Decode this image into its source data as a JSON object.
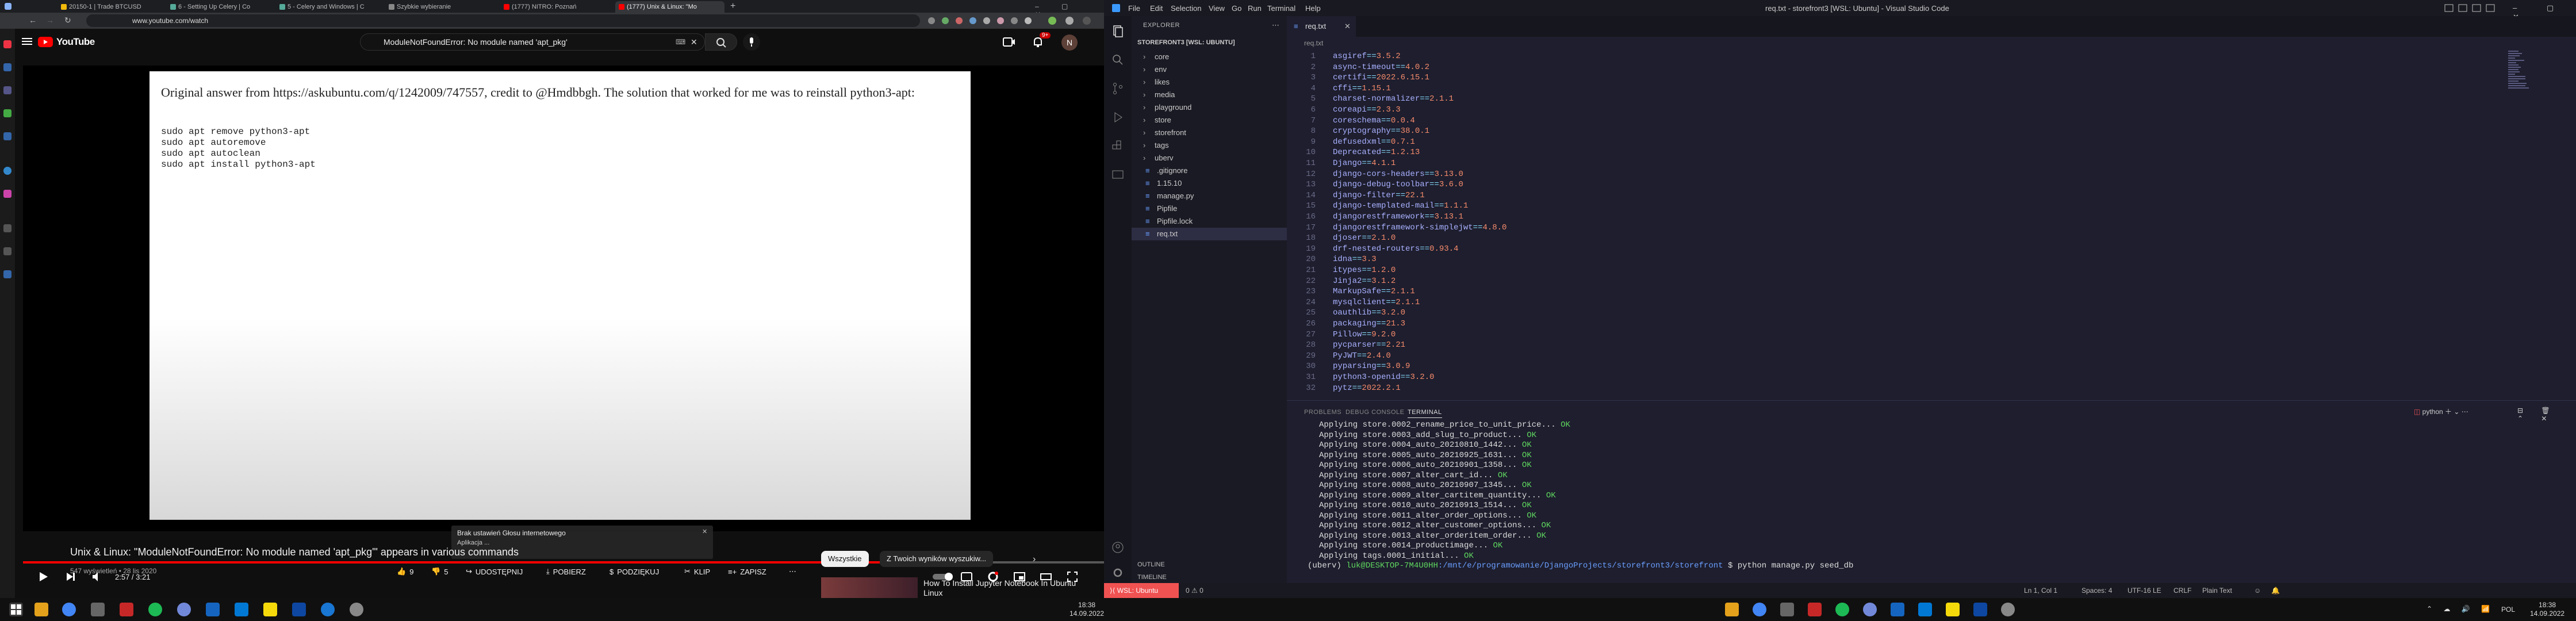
{
  "chrome": {
    "tabs": [
      {
        "label": "20150-1 | Trade BTCUSD"
      },
      {
        "label": "6 - Setting Up Celery | Co"
      },
      {
        "label": "5 - Celery and Windows | C"
      },
      {
        "label": "Szybkie wybieranie"
      },
      {
        "label": "(1777) NITRO: Poznań"
      },
      {
        "label": "(1777) Unix & Linux: \"Mo"
      }
    ],
    "url": "www.youtube.com/watch"
  },
  "youtube": {
    "logo_text": "YouTube",
    "search_value": "ModuleNotFoundError: No module named 'apt_pkg'",
    "notification_count": "9+",
    "avatar_letter": "N",
    "answer_text": "Original answer from https://askubuntu.com/q/1242009/747557, credit to @Hmdbbgh. The solution that worked for me was to reinstall python3-apt:",
    "code_lines": [
      "sudo apt remove python3-apt",
      "sudo apt autoremove",
      "sudo apt autoclean",
      "sudo apt install python3-apt"
    ],
    "popup_title": "Brak ustawień Głosu internetowego",
    "popup_body": "Aplikacja ...",
    "time": "2:57 / 3:21",
    "progress": 0.89,
    "video_title": "Unix & Linux: \"ModuleNotFoundError: No module named 'apt_pkg'\" appears in various commands",
    "video_meta": "547 wyświetleń • 28 lis 2020",
    "likes": "9",
    "dislikes": "5",
    "share_label": "UDOSTĘPNIJ",
    "download_label": "POBIERZ",
    "thanks_label": "PODZIĘKUJ",
    "clip_label": "KLIP",
    "save_label": "ZAPISZ",
    "chip_all": "Wszystkie",
    "chip_search": "Z Twoich wyników wyszukiw...",
    "rec_title": "How To Install Jupyter Notebook In Ubuntu Linux",
    "accent": "#ff0000"
  },
  "vscode": {
    "menu": [
      "File",
      "Edit",
      "Selection",
      "View",
      "Go",
      "Run",
      "Terminal",
      "Help"
    ],
    "window_title": "req.txt - storefront3 [WSL: Ubuntu] - Visual Studio Code",
    "explorer_header": "EXPLORER",
    "project_name": "STOREFRONT3 [WSL: UBUNTU]",
    "tree": [
      {
        "label": "core",
        "type": "folder"
      },
      {
        "label": "env",
        "type": "folder"
      },
      {
        "label": "likes",
        "type": "folder"
      },
      {
        "label": "media",
        "type": "folder"
      },
      {
        "label": "playground",
        "type": "folder"
      },
      {
        "label": "store",
        "type": "folder"
      },
      {
        "label": "storefront",
        "type": "folder"
      },
      {
        "label": "tags",
        "type": "folder"
      },
      {
        "label": "uberv",
        "type": "folder"
      },
      {
        "label": ".gitignore",
        "type": "file"
      },
      {
        "label": "1.15.10",
        "type": "file"
      },
      {
        "label": "manage.py",
        "type": "file"
      },
      {
        "label": "Pipfile",
        "type": "file"
      },
      {
        "label": "Pipfile.lock",
        "type": "file"
      },
      {
        "label": "req.txt",
        "type": "file"
      }
    ],
    "outline_label": "OUTLINE",
    "timeline_label": "TIMELINE",
    "editor_tab": "req.txt",
    "breadcrumb": "req.txt",
    "code": [
      [
        "asgiref",
        "3.5.2"
      ],
      [
        "async-timeout",
        "4.0.2"
      ],
      [
        "certifi",
        "2022.6.15.1"
      ],
      [
        "cffi",
        "1.15.1"
      ],
      [
        "charset-normalizer",
        "2.1.1"
      ],
      [
        "coreapi",
        "2.3.3"
      ],
      [
        "coreschema",
        "0.0.4"
      ],
      [
        "cryptography",
        "38.0.1"
      ],
      [
        "defusedxml",
        "0.7.1"
      ],
      [
        "Deprecated",
        "1.2.13"
      ],
      [
        "Django",
        "4.1.1"
      ],
      [
        "django-cors-headers",
        "3.13.0"
      ],
      [
        "django-debug-toolbar",
        "3.6.0"
      ],
      [
        "django-filter",
        "22.1"
      ],
      [
        "django-templated-mail",
        "1.1.1"
      ],
      [
        "djangorestframework",
        "3.13.1"
      ],
      [
        "djangorestframework-simplejwt",
        "4.8.0"
      ],
      [
        "djoser",
        "2.1.0"
      ],
      [
        "drf-nested-routers",
        "0.93.4"
      ],
      [
        "idna",
        "3.3"
      ],
      [
        "itypes",
        "1.2.0"
      ],
      [
        "Jinja2",
        "3.1.2"
      ],
      [
        "MarkupSafe",
        "2.1.1"
      ],
      [
        "mysqlclient",
        "2.1.1"
      ],
      [
        "oauthlib",
        "3.2.0"
      ],
      [
        "packaging",
        "21.3"
      ],
      [
        "Pillow",
        "9.2.0"
      ],
      [
        "pycparser",
        "2.21"
      ],
      [
        "PyJWT",
        "2.4.0"
      ],
      [
        "pyparsing",
        "3.0.9"
      ],
      [
        "python3-openid",
        "3.2.0"
      ],
      [
        "pytz",
        "2022.2.1"
      ]
    ],
    "panel_tabs": [
      "PROBLEMS",
      "DEBUG CONSOLE",
      "TERMINAL"
    ],
    "terminal_shell": "python",
    "terminal_lines": [
      "Applying store.0002_rename_price_to_unit_price...",
      "Applying store.0003_add_slug_to_product...",
      "Applying store.0004_auto_20210810_1442...",
      "Applying store.0005_auto_20210925_1631...",
      "Applying store.0006_auto_20210901_1358...",
      "Applying store.0007_alter_cart_id...",
      "Applying store.0008_auto_20210907_1345...",
      "Applying store.0009_alter_cartitem_quantity...",
      "Applying store.0010_auto_20210913_1514...",
      "Applying store.0011_alter_order_options...",
      "Applying store.0012_alter_customer_options...",
      "Applying store.0013_alter_orderitem_order...",
      "Applying store.0014_productimage...",
      "Applying tags.0001_initial..."
    ],
    "ok_label": "OK",
    "prompt_env": "(uberv)",
    "prompt_host": "luk@DESKTOP-7M4U0HH",
    "prompt_path": ":/mnt/e/programowanie/DjangoProjects/storefront3/storefront",
    "prompt_cmd": "$ python manage.py seed_db",
    "status_remote": "WSL: Ubuntu",
    "status_problems": "0 ⚠ 0",
    "status_right": [
      "Ln 1, Col 1",
      "Spaces: 4",
      "UTF-16 LE",
      "CRLF",
      "Plain Text"
    ]
  },
  "taskbar": {
    "left_time": "18:38",
    "left_date": "14.09.2022",
    "right_time": "18:38",
    "right_date": "14.09.2022",
    "lang": "POL"
  }
}
